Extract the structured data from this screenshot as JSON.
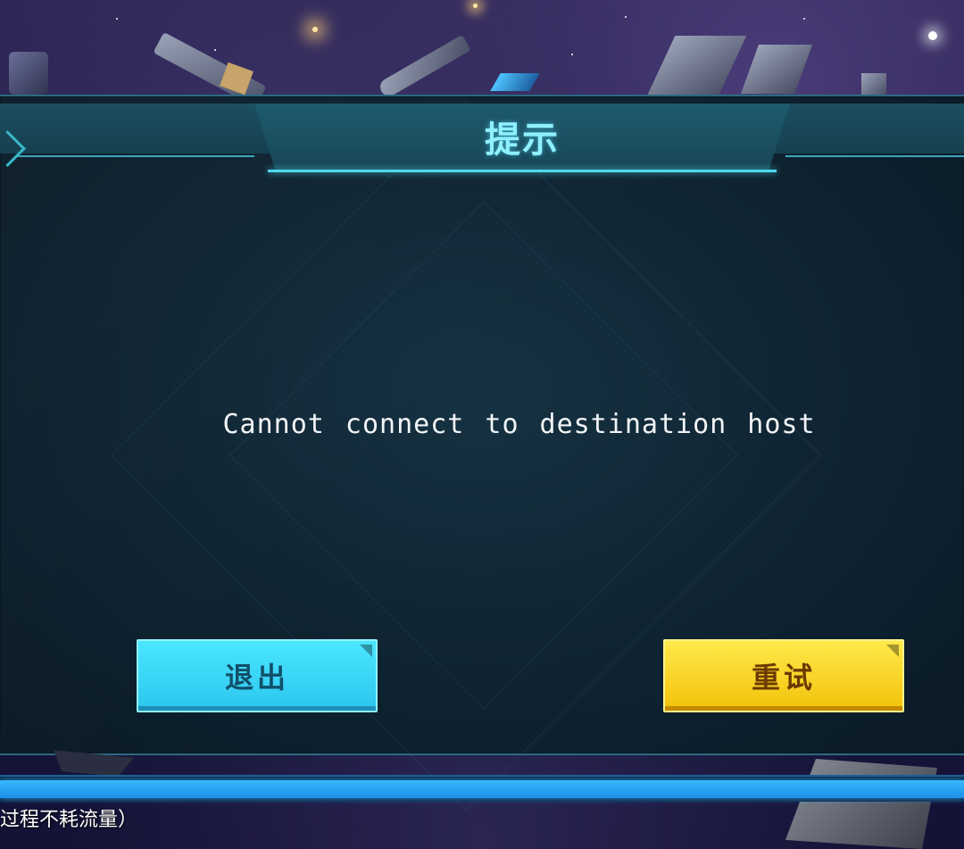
{
  "dialog": {
    "title": "提示",
    "message": "Cannot connect to destination host",
    "buttons": {
      "exit_label": "退出",
      "retry_label": "重试"
    }
  },
  "loading": {
    "status_text": "过程不耗流量）",
    "progress_percent": 100
  },
  "colors": {
    "title": "#8ff0ff",
    "exit_button": "#2cc6ee",
    "retry_button": "#f3c20b",
    "progress": "#38b8ff"
  },
  "icons": {
    "dialog_corner": "corner-chevron-icon",
    "button_corner": "corner-notch-icon"
  }
}
